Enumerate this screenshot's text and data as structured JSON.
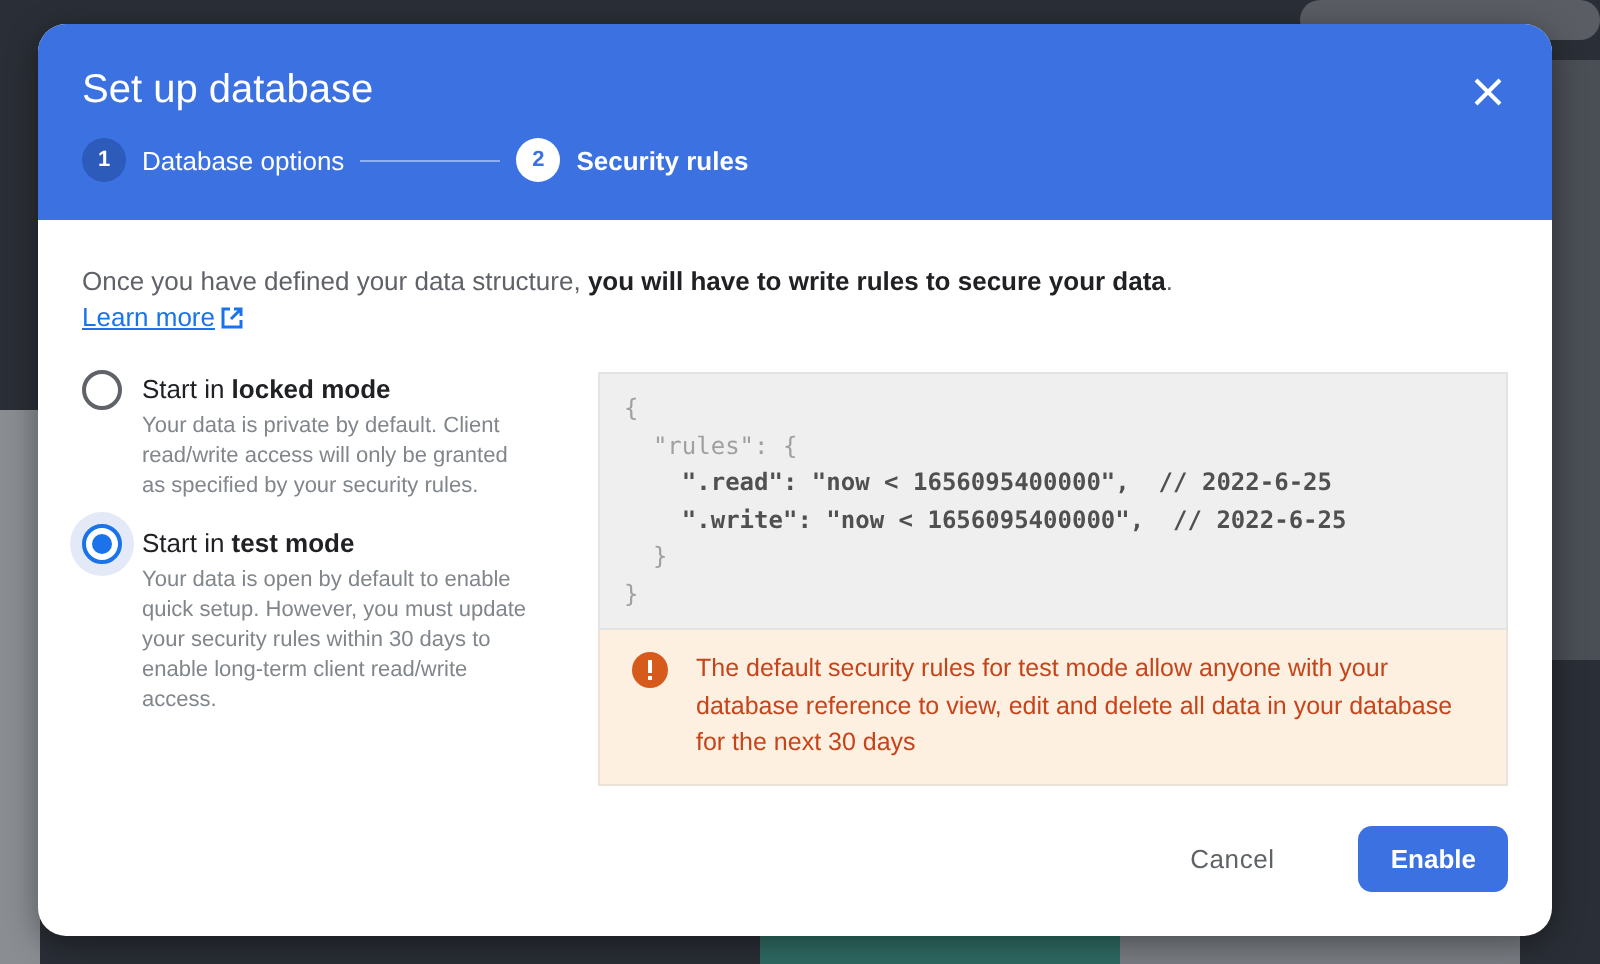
{
  "dialog": {
    "title": "Set up database",
    "steps": [
      {
        "number": "1",
        "label": "Database options",
        "selected": false
      },
      {
        "number": "2",
        "label": "Security rules",
        "selected": true
      }
    ],
    "intro": "Once you have defined your data structure, **you will have to write rules to secure your data**.",
    "learn_more": "Learn more",
    "options": [
      {
        "label": "Start in **locked mode**",
        "description": "Your data is private by default. Client read/write access will only be granted as specified by your security rules.",
        "selected": false
      },
      {
        "label": "Start in **test mode**",
        "description": "Your data is open by default to enable quick setup. However, you must update your security rules within 30 days to enable long-term client read/write access.",
        "selected": true
      }
    ],
    "code": [
      {
        "text": "{",
        "muted": true
      },
      {
        "text": "  \"rules\": {",
        "muted": true
      },
      {
        "text": "    \".read\": \"now < 1656095400000\",  // 2022-6-25",
        "muted": false
      },
      {
        "text": "    \".write\": \"now < 1656095400000\",  // 2022-6-25",
        "muted": false
      },
      {
        "text": "  }",
        "muted": true
      },
      {
        "text": "}",
        "muted": true
      }
    ],
    "warning": "The default security rules for test mode allow anyone with your database reference to view, edit and delete all data in your database for the next 30 days",
    "buttons": [
      {
        "label": "Cancel",
        "kind": "text"
      },
      {
        "label": "Enable",
        "kind": "primary"
      }
    ]
  }
}
